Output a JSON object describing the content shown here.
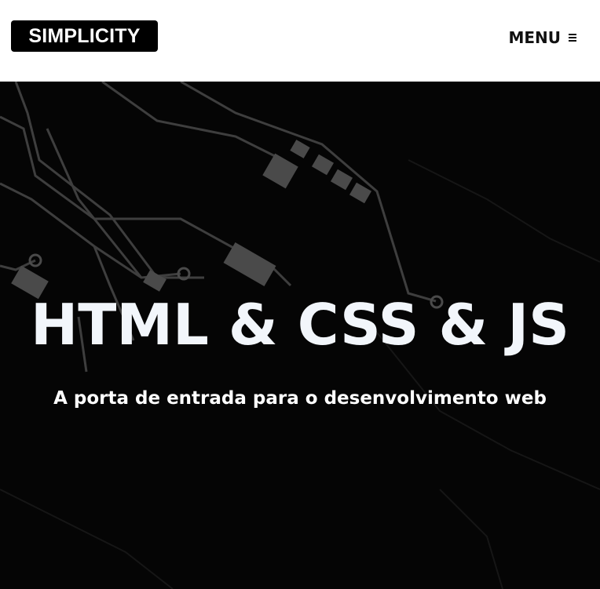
{
  "header": {
    "logo_text": "SIMPLICITY",
    "menu_label": "MENU",
    "menu_icon": "hamburger-icon"
  },
  "hero": {
    "title": "HTML & CSS & JS",
    "subtitle": "A porta de entrada para o desenvolvimento web",
    "background_image": "circuit-board-image"
  },
  "colors": {
    "header_bg": "#ffffff",
    "logo_bg": "#000000",
    "logo_text": "#ffffff",
    "hero_bg": "#050505",
    "hero_title": "#f2f6fb",
    "circuit_lines": "#4a4a4a"
  }
}
